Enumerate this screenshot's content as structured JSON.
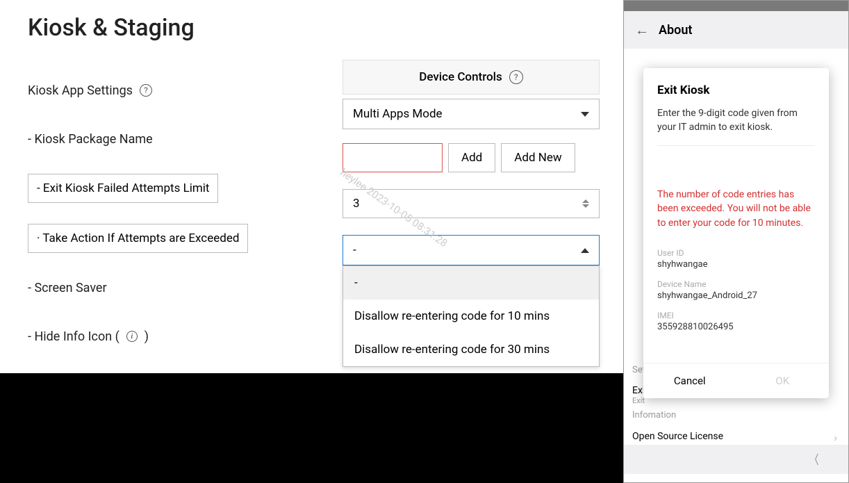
{
  "page": {
    "title": "Kiosk & Staging"
  },
  "header": {
    "deviceControls": "Device Controls"
  },
  "labels": {
    "kioskAppSettings": "Kiosk App Settings",
    "kioskPackageName": "- Kiosk Package Name",
    "exitFailedLimit": "- Exit Kiosk Failed Attempts Limit",
    "takeAction": "· Take Action If Attempts are Exceeded",
    "screenSaver": "- Screen Saver",
    "hideInfoIcon": "- Hide Info Icon (",
    "hideInfoIconClose": ")"
  },
  "controls": {
    "modeSelect": "Multi Apps Mode",
    "packageInput": "",
    "addBtn": "Add",
    "addNewBtn": "Add New",
    "limitValue": "3",
    "actionSelect": "-",
    "options": {
      "blank": "-",
      "opt10": "Disallow re-entering code for 10 mins",
      "opt30": "Disallow re-entering code for 30 mins"
    }
  },
  "watermark": "heylee 2023-10-05 08:31:28",
  "mobile": {
    "headerTitle": "About",
    "modal": {
      "title": "Exit Kiosk",
      "desc": "Enter the 9-digit code given from your IT admin to exit kiosk.",
      "error": "The number of code entries has been exceeded. You will not be able to enter your code for 10 minutes.",
      "userIdLabel": "User ID",
      "userId": "shyhwangae",
      "deviceNameLabel": "Device Name",
      "deviceName": "shyhwangae_Android_27",
      "imeiLabel": "IMEI",
      "imei": "355928810026495",
      "cancel": "Cancel",
      "ok": "OK"
    },
    "bg": {
      "settings": "Settings",
      "exit": "Exi",
      "exitSub": "Exit",
      "information": "Infomation",
      "openSource": "Open Source License"
    }
  }
}
